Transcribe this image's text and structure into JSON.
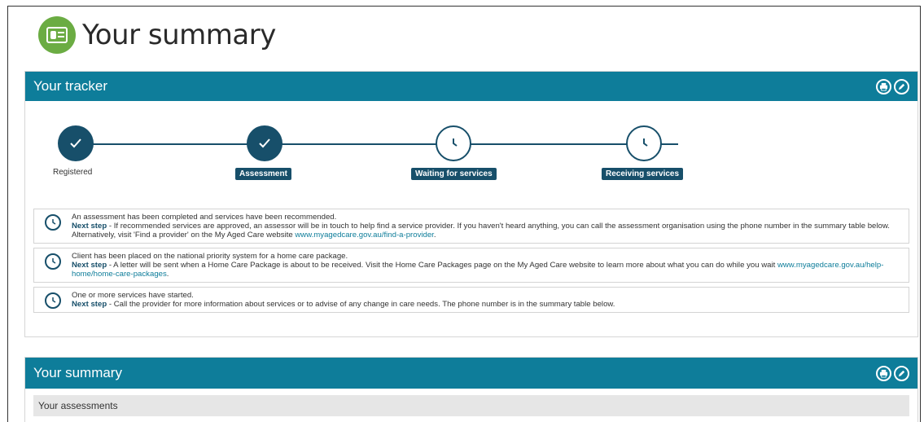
{
  "page": {
    "title": "Your summary",
    "icon": "id-card-icon",
    "accent": "#6bac43"
  },
  "tracker": {
    "title": "Your tracker",
    "bar_color": "#0e7d9a",
    "steps": [
      {
        "label": "Registered",
        "status": "done"
      },
      {
        "label": "Assessment",
        "status": "done"
      },
      {
        "label": "Waiting for services",
        "status": "pending"
      },
      {
        "label": "Receiving services",
        "status": "pending"
      }
    ],
    "messages": [
      {
        "text": "An assessment has been completed and services have been recommended.",
        "next_label": "Next step",
        "next_text": " - If recommended services are approved, an assessor will be in touch to help find a service provider. If you haven't heard anything, you can call the assessment organisation using the phone number in the summary table below. Alternatively, visit 'Find a provider' on the My Aged Care website ",
        "link": "www.myagedcare.gov.au/find-a-provider",
        "tail": "."
      },
      {
        "text": "Client has been placed on the national priority system for a home care package.",
        "next_label": "Next step",
        "next_text": " - A letter will be sent when a Home Care Package is about to be received. Visit the Home Care Packages page on the My Aged Care website to learn more about what you can do while you wait ",
        "link": "www.myagedcare.gov.au/help-home/home-care-packages",
        "tail": "."
      },
      {
        "text": "One or more services have started.",
        "next_label": "Next step",
        "next_text": " - Call the provider for more information about services or to advise of any change in care needs. The phone number is in the summary table below.",
        "link": "",
        "tail": ""
      }
    ]
  },
  "summary": {
    "title": "Your summary",
    "section_label": "Your assessments"
  },
  "actions": {
    "print": "print-icon",
    "edit": "edit-icon"
  }
}
